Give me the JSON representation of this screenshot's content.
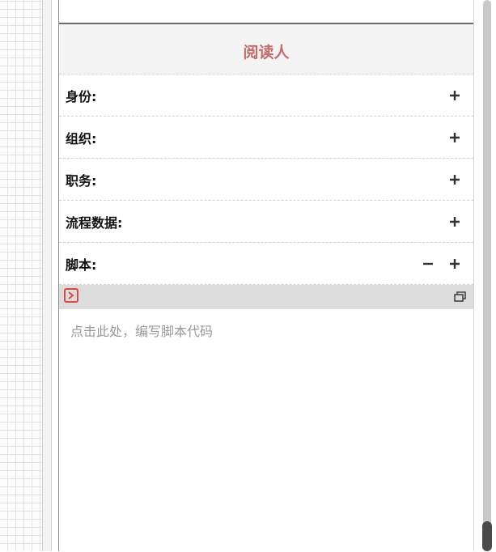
{
  "section": {
    "title": "阅读人"
  },
  "rows": [
    {
      "label": "身份:"
    },
    {
      "label": "组织:"
    },
    {
      "label": "职务:"
    },
    {
      "label": "流程数据:"
    },
    {
      "label": "脚本:"
    }
  ],
  "script_editor": {
    "placeholder": "点击此处，编写脚本代码",
    "toolbar_icon_left": "run-script-icon",
    "toolbar_icon_right": "restore-window-icon"
  },
  "colors": {
    "title": "#c46b6b",
    "run_icon": "#e04848",
    "toolbar_bg": "#dcdcdc"
  }
}
